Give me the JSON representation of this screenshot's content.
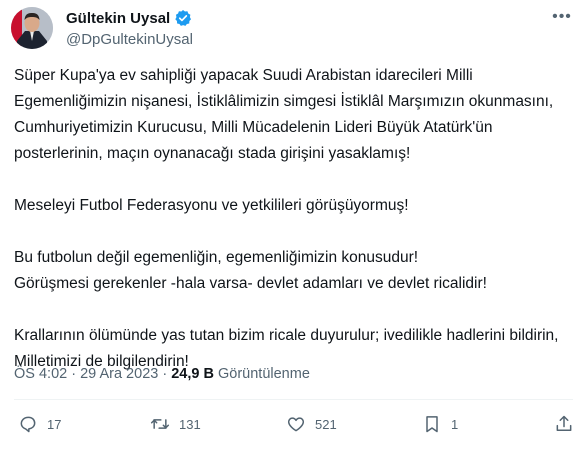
{
  "author": {
    "name": "Gültekin Uysal",
    "handle": "@DpGultekinUysal",
    "verified_color": "#1d9bf0"
  },
  "tweet": {
    "paragraphs": [
      "Süper Kupa'ya ev sahipliği yapacak Suudi Arabistan idarecileri Milli Egemenliğimizin nişanesi, İstiklâlimizin simgesi İstiklâl Marşımızın okunmasını, Cumhuriyetimizin Kurucusu, Milli Mücadelenin Lideri Büyük Atatürk'ün posterlerinin, maçın oynanacağı stada girişini yasaklamış!",
      "Meseleyi Futbol Federasyonu ve yetkilileri görüşüyormuş!",
      "Bu futbolun değil egemenliğin, egemenliğimizin konusudur!\nGörüşmesi gerekenler -hala varsa- devlet adamları ve devlet ricalidir!",
      "Krallarının ölümünde yas tutan bizim ricale duyurulur; ivedilikle hadlerini bildirin, Milletimizi de bilgilendirin!"
    ]
  },
  "meta": {
    "time": "ÖS 4:02",
    "separator": "·",
    "date": "29 Ara 2023",
    "views_count": "24,9 B",
    "views_label": "Görüntülenme"
  },
  "actions": {
    "reply_count": "17",
    "retweet_count": "131",
    "like_count": "521",
    "bookmark_count": "1"
  },
  "icons": {
    "reply": "reply-icon",
    "retweet": "retweet-icon",
    "like": "heart-icon",
    "bookmark": "bookmark-icon",
    "share": "share-icon",
    "verified": "verified-badge-icon",
    "more": "more-icon"
  }
}
